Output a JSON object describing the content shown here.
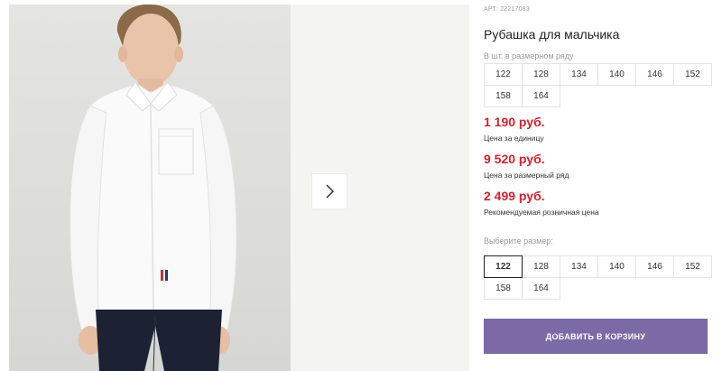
{
  "gallery": {
    "next_icon": "chevron-right-icon"
  },
  "product": {
    "article": "АРТ: 22217083",
    "title": "Рубашка для мальчика",
    "row_caption": "В шт. в размерном ряду",
    "row_sizes": [
      "122",
      "128",
      "134",
      "140",
      "146",
      "152",
      "158",
      "164"
    ],
    "prices": [
      {
        "value": "1 190 руб.",
        "note": "Цена за единицу"
      },
      {
        "value": "9 520 руб.",
        "note": "Цена за размерный ряд"
      },
      {
        "value": "2 499 руб.",
        "note": "Рекомендуемая розничная цена"
      }
    ],
    "choose_caption": "Выберите размер:",
    "sizes": [
      "122",
      "128",
      "134",
      "140",
      "146",
      "152",
      "158",
      "164"
    ],
    "selected_size": "122",
    "cart_button": "ДОБАВИТЬ В КОРЗИНУ"
  },
  "colors": {
    "price": "#d8202f",
    "cart_button": "#7b6aa5"
  }
}
